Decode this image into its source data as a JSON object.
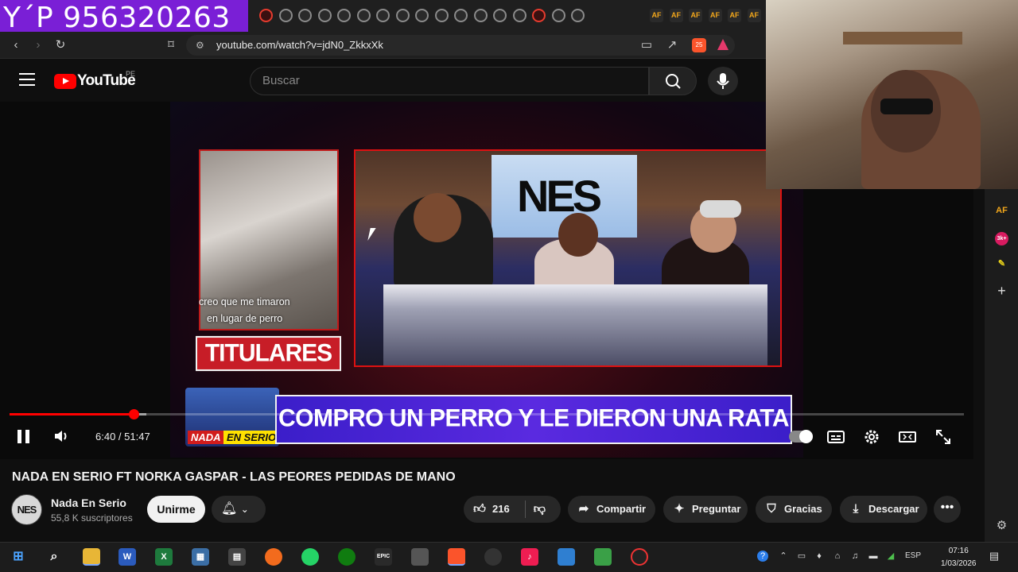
{
  "overlay": {
    "phone_text": "Y´P 956320263"
  },
  "browser": {
    "url": "youtube.com/watch?v=jdN0_ZkkxXk",
    "nav": {
      "back": "‹",
      "forward": "›",
      "reload": "↻"
    },
    "tab_icons": [
      "tab-icon",
      "tab-icon",
      "tab-icon",
      "tab-icon",
      "tab-icon",
      "tab-icon",
      "tab-icon",
      "tab-icon",
      "tab-icon",
      "tab-icon",
      "tab-icon",
      "tab-icon",
      "tab-icon",
      "tab-icon",
      "tab-icon",
      "tab-icon",
      "tab-icon"
    ],
    "af_label": "AF",
    "brave_badge": "25"
  },
  "youtube": {
    "logo_word": "YouTube",
    "region": "PE",
    "search_placeholder": "Buscar"
  },
  "video": {
    "clip_subtitle_1": "creo que me timaron",
    "clip_subtitle_2": "en lugar de perro",
    "titulares": "TITULARES",
    "studio_logo": "NES",
    "logo_nada": "NADA",
    "logo_serio": "EN SERIO",
    "headline": "COMPRO UN  PERRO Y LE DIERON UNA RATA",
    "time": "6:40 / 51:47",
    "progress_fraction": 0.13
  },
  "info": {
    "title": "NADA EN SERIO FT NORKA GASPAR - LAS PEORES PEDIDAS DE MANO",
    "channel_avatar_text": "NES",
    "channel_name": "Nada En Serio",
    "subscribers": "55,8 K suscriptores",
    "join": "Unirme",
    "likes": "216",
    "share": "Compartir",
    "ask": "Preguntar",
    "thanks": "Gracias",
    "download": "Descargar",
    "more": "•••"
  },
  "rail": {
    "af": "AF",
    "badge": "3k+",
    "plus": "+"
  },
  "taskbar": {
    "language": "ESP",
    "time": "07:16",
    "date": "1/03/2026",
    "apps": [
      "start",
      "search",
      "file-explorer",
      "word",
      "excel",
      "calculator",
      "calendar",
      "app-orange",
      "whatsapp",
      "xbox",
      "epic-games",
      "game-pad",
      "brave",
      "app-circle",
      "tiktok",
      "app-blue",
      "app-green",
      "app-red"
    ]
  }
}
